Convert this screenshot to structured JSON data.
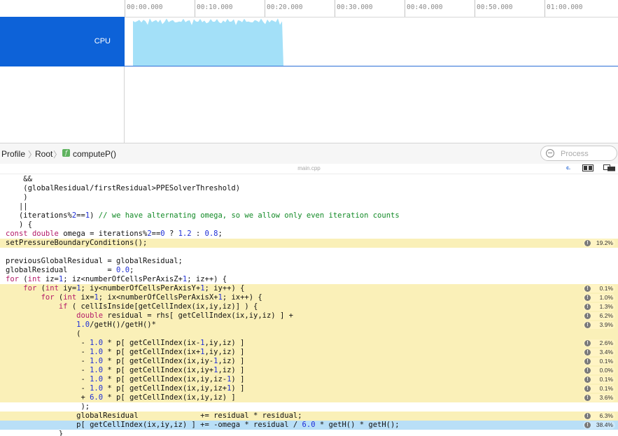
{
  "timeline": {
    "ticks": [
      "00:00.000",
      "00:10.000",
      "00:20.000",
      "00:30.000",
      "00:40.000",
      "00:50.000",
      "01:00.000"
    ],
    "track_label": "CPU"
  },
  "navbar": {
    "crumbs": [
      "Profile",
      "Root",
      "computeP()"
    ],
    "function_icon": "function-icon",
    "search_placeholder": "Process"
  },
  "editor": {
    "filename": "main.cpp",
    "toolbar_icons": [
      "cursor-button-icon",
      "split-view-icon",
      "layout-toggle-icon"
    ]
  },
  "colors": {
    "track_blue": "#0d62d8",
    "cpu_fill": "#a3e0f8",
    "hot_line": "#faf0b8",
    "selected_line": "#b9dff7"
  },
  "code_lines": [
    {
      "text": "    &&",
      "pct": null
    },
    {
      "text": "    (globalResidual/firstResidual>PPESolverThreshold)",
      "pct": null
    },
    {
      "text": "    )",
      "pct": null
    },
    {
      "text": "   ||",
      "pct": null
    },
    {
      "text": "   (iterations%2==1) // we have alternating omega, so we allow only even iteration counts",
      "pct": null
    },
    {
      "text": "   ) {",
      "pct": null
    },
    {
      "text": "const double omega = iterations%2==0 ? 1.2 : 0.8;",
      "pct": null
    },
    {
      "text": "setPressureBoundaryConditions();",
      "pct": "19.2%"
    },
    {
      "text": "",
      "pct": null
    },
    {
      "text": "previousGlobalResidual = globalResidual;",
      "pct": null
    },
    {
      "text": "globalResidual         = 0.0;",
      "pct": null
    },
    {
      "text": "for (int iz=1; iz<numberOfCellsPerAxisZ+1; iz++) {",
      "pct": null
    },
    {
      "text": "    for (int iy=1; iy<numberOfCellsPerAxisY+1; iy++) {",
      "pct": "0.1%"
    },
    {
      "text": "        for (int ix=1; ix<numberOfCellsPerAxisX+1; ix++) {",
      "pct": "1.0%"
    },
    {
      "text": "            if ( cellIsInside[getCellIndex(ix,iy,iz)] ) {",
      "pct": "1.3%"
    },
    {
      "text": "                double residual = rhs[ getCellIndex(ix,iy,iz) ] +",
      "pct": "6.2%"
    },
    {
      "text": "                1.0/getH()/getH()*",
      "pct": "3.9%"
    },
    {
      "text": "                (",
      "pct": ""
    },
    {
      "text": "                 - 1.0 * p[ getCellIndex(ix-1,iy,iz) ]",
      "pct": "2.6%"
    },
    {
      "text": "                 - 1.0 * p[ getCellIndex(ix+1,iy,iz) ]",
      "pct": "3.4%"
    },
    {
      "text": "                 - 1.0 * p[ getCellIndex(ix,iy-1,iz) ]",
      "pct": "0.1%"
    },
    {
      "text": "                 - 1.0 * p[ getCellIndex(ix,iy+1,iz) ]",
      "pct": "0.0%"
    },
    {
      "text": "                 - 1.0 * p[ getCellIndex(ix,iy,iz-1) ]",
      "pct": "0.1%"
    },
    {
      "text": "                 - 1.0 * p[ getCellIndex(ix,iy,iz+1) ]",
      "pct": "0.1%"
    },
    {
      "text": "                 + 6.0 * p[ getCellIndex(ix,iy,iz) ]",
      "pct": "3.6%"
    },
    {
      "text": "                 );",
      "pct": null
    },
    {
      "text": "                globalResidual              += residual * residual;",
      "pct": "6.3%"
    },
    {
      "text": "                p[ getCellIndex(ix,iy,iz) ] += -omega * residual / 6.0 * getH() * getH();",
      "pct": "38.4%"
    },
    {
      "text": "            }",
      "pct": null
    }
  ],
  "selected_line_index": 27
}
